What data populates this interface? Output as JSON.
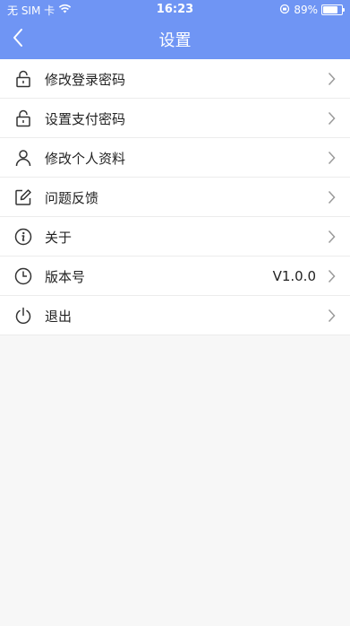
{
  "status_bar": {
    "carrier": "无 SIM 卡",
    "time": "16:23",
    "battery_text": "89%",
    "battery_level": 0.89
  },
  "nav": {
    "title": "设置"
  },
  "menu": [
    {
      "label": "修改登录密码",
      "icon": "lock-icon",
      "value": ""
    },
    {
      "label": "设置支付密码",
      "icon": "lock-icon",
      "value": ""
    },
    {
      "label": "修改个人资料",
      "icon": "user-icon",
      "value": ""
    },
    {
      "label": "问题反馈",
      "icon": "edit-icon",
      "value": ""
    },
    {
      "label": "关于",
      "icon": "info-icon",
      "value": ""
    },
    {
      "label": "版本号",
      "icon": "clock-icon",
      "value": "V1.0.0"
    },
    {
      "label": "退出",
      "icon": "power-icon",
      "value": ""
    }
  ],
  "colors": {
    "header": "#6f95f4",
    "icon": "#333333",
    "chevron": "#9a9a9a"
  }
}
